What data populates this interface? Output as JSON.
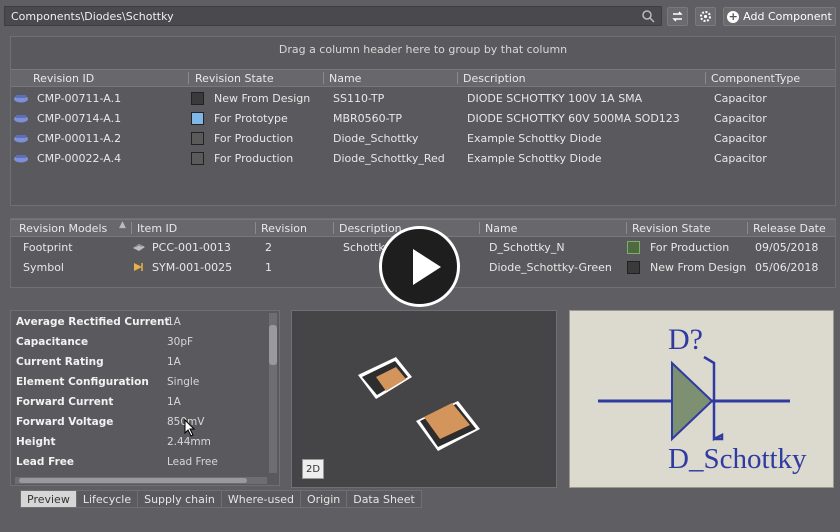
{
  "path": "Components\\Diodes\\Schottky",
  "toolbar": {
    "add_label": "Add Component"
  },
  "group_hint": "Drag a column header here to group by that column",
  "top_columns": [
    "Revision ID",
    "Revision State",
    "Name",
    "Description",
    "ComponentType"
  ],
  "top_rows": [
    {
      "id": "CMP-00711-A.1",
      "state": "New From Design",
      "state_color": "#3a3a3a",
      "name": "SS110-TP",
      "desc": "DIODE SCHOTTKY 100V 1A SMA",
      "type": "Capacitor"
    },
    {
      "id": "CMP-00714-A.1",
      "state": "For Prototype",
      "state_color": "#7fb8e6",
      "name": "MBR0560-TP",
      "desc": "DIODE SCHOTTKY 60V 500MA SOD123",
      "type": "Capacitor"
    },
    {
      "id": "CMP-00011-A.2",
      "state": "For Production",
      "state_color": "#5a5a5a",
      "name": "Diode_Schottky",
      "desc": "Example Schottky Diode",
      "type": "Capacitor"
    },
    {
      "id": "CMP-00022-A.4",
      "state": "For Production",
      "state_color": "#5a5a5a",
      "name": "Diode_Schottky_Red",
      "desc": "Example Schottky Diode",
      "type": "Capacitor"
    }
  ],
  "mid_columns": [
    "Revision Models",
    "Item ID",
    "Revision",
    "Description",
    "Name",
    "Revision State",
    "Release Date"
  ],
  "mid_rows": [
    {
      "model": "Footprint",
      "item": "PCC-001-0013",
      "rev": "2",
      "desc": "Schottky",
      "name": "D_Schottky_N",
      "state": "For Production",
      "state_color": "#4d6b3e",
      "date": "09/05/2018"
    },
    {
      "model": "Symbol",
      "item": "SYM-001-0025",
      "rev": "1",
      "desc": "",
      "name": "Diode_Schottky-Green",
      "state": "New From Design",
      "state_color": "#3a3a3a",
      "date": "05/06/2018"
    }
  ],
  "properties": [
    {
      "k": "Average Rectified Current",
      "v": "1A"
    },
    {
      "k": "Capacitance",
      "v": "30pF"
    },
    {
      "k": "Current Rating",
      "v": "1A"
    },
    {
      "k": "Element Configuration",
      "v": "Single"
    },
    {
      "k": "Forward Current",
      "v": "1A"
    },
    {
      "k": "Forward Voltage",
      "v": "850mV"
    },
    {
      "k": "Height",
      "v": "2.44mm"
    },
    {
      "k": "Lead Free",
      "v": "Lead Free"
    }
  ],
  "preview_btn": "2D",
  "symbol": {
    "designator": "D?",
    "name": "D_Schottky"
  },
  "tabs": [
    "Preview",
    "Lifecycle",
    "Supply chain",
    "Where-used",
    "Origin",
    "Data Sheet"
  ]
}
